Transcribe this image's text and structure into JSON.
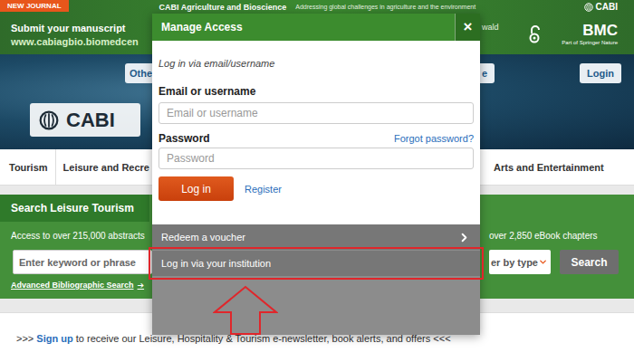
{
  "banner": {
    "badge": "NEW JOURNAL",
    "journal": "CABI Agriculture and Bioscience",
    "tagline": "Addressing global challenges in agriculture and the environment",
    "corner_logo": "CABI",
    "submit": "Submit your manuscript",
    "url": "www.cabiagbio.biomedcen",
    "cut_text": "wald",
    "publisher": "BMC",
    "publisher_sub": "Part of Springer Nature"
  },
  "header": {
    "other_button": "Othe",
    "logo": "CABI",
    "right_button": "e",
    "login": "Login"
  },
  "nav": {
    "left": [
      "Tourism",
      "Leisure and Recre"
    ],
    "right": [
      "Arts and Entertainment"
    ]
  },
  "search": {
    "tab": "Search Leisure Tourism",
    "intro_left": "Access to over 215,000 abstracts",
    "intro_right": "over 2,850 eBook chapters",
    "placeholder": "Enter keyword or phrase",
    "filter": "er by type",
    "button": "Search",
    "advanced": "Advanced Bibliographic Search",
    "advanced_arrow": "➔"
  },
  "signup": {
    "before": ">>>",
    "link": "Sign up",
    "after": "to receive our Leisure, Hospitality & Tourism e-newsletter, book alerts, and offers <<<"
  },
  "modal": {
    "title": "Manage Access",
    "close": "×",
    "intro": "Log in via email/username",
    "email_label": "Email or username",
    "email_placeholder": "Email or username",
    "password_label": "Password",
    "forgot": "Forgot password?",
    "password_placeholder": "Password",
    "login_button": "Log in",
    "register": "Register",
    "options": [
      {
        "label": "Redeem a voucher",
        "chevron": true,
        "highlighted": false
      },
      {
        "label": "Log in via your institution",
        "chevron": false,
        "highlighted": true
      }
    ]
  }
}
